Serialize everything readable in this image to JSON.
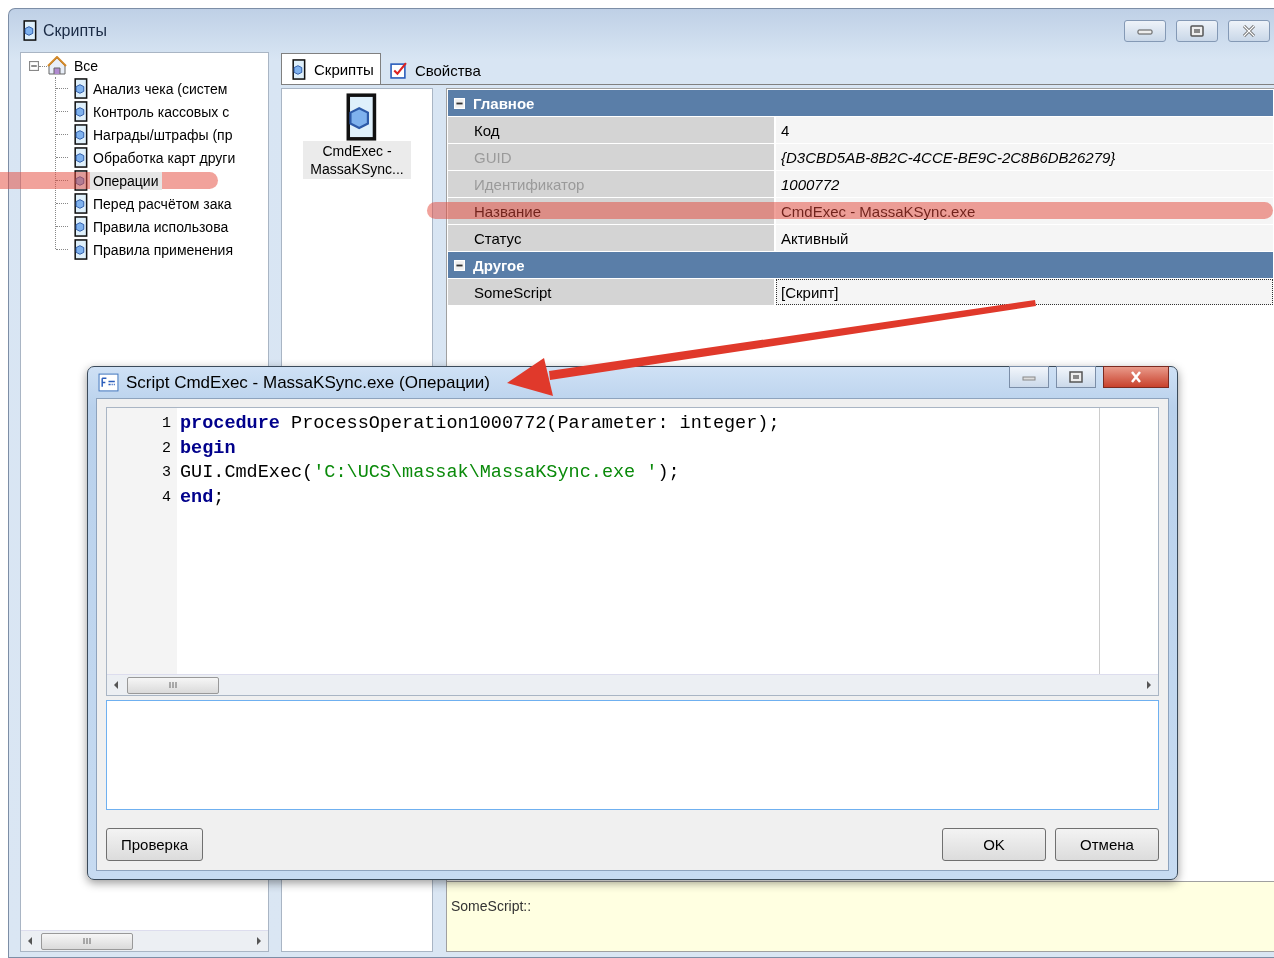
{
  "window": {
    "title": "Скрипты"
  },
  "tree": {
    "label": "Все",
    "expanded": true,
    "children": [
      {
        "label": "Анализ чека (систем",
        "selected": false,
        "highlighted": false
      },
      {
        "label": "Контроль кассовых с",
        "selected": false,
        "highlighted": false
      },
      {
        "label": "Награды/штрафы (пр",
        "selected": false,
        "highlighted": false
      },
      {
        "label": "Обработка карт други",
        "selected": false,
        "highlighted": false
      },
      {
        "label": "Операции",
        "selected": true,
        "highlighted": true
      },
      {
        "label": "Перед расчётом зака",
        "selected": false,
        "highlighted": false
      },
      {
        "label": "Правила использова",
        "selected": false,
        "highlighted": false
      },
      {
        "label": "Правила применения",
        "selected": false,
        "highlighted": false
      }
    ]
  },
  "tabs": [
    {
      "label": "Скрипты",
      "selected": true
    },
    {
      "label": "Свойства",
      "selected": false
    }
  ],
  "scripts": [
    {
      "label": "CmdExec - MassaKSync...",
      "selected": true
    }
  ],
  "properties": [
    {
      "title": "Главное",
      "expanded": true,
      "rows": [
        {
          "name": "Код",
          "value": "4",
          "disabled": false,
          "highlighted": false,
          "selected": false
        },
        {
          "name": "GUID",
          "value": "{D3CBD5AB-8B2C-4CCE-BE9C-2C8B6DB26279}",
          "disabled": true,
          "highlighted": false,
          "selected": false
        },
        {
          "name": "Идентификатор",
          "value": "1000772",
          "disabled": true,
          "highlighted": false,
          "selected": false
        },
        {
          "name": "Название",
          "value": "CmdExec - MassaKSync.exe",
          "disabled": false,
          "highlighted": true,
          "selected": false
        },
        {
          "name": "Статус",
          "value": "Активный",
          "disabled": false,
          "highlighted": false,
          "selected": false
        }
      ]
    },
    {
      "title": "Другое",
      "expanded": true,
      "rows": [
        {
          "name": "SomeScript",
          "value": "[Скрипт]",
          "disabled": false,
          "highlighted": false,
          "selected": true
        }
      ]
    }
  ],
  "description": "SomeScript::",
  "dialog": {
    "title": "Script CmdExec - MassaKSync.exe (Операции)",
    "code": [
      {
        "number": "1",
        "tokens": [
          {
            "kind": "keyword",
            "text": "procedure"
          },
          {
            "kind": "plain",
            "text": " ProcessOperation1000772(Parameter: integer);"
          }
        ]
      },
      {
        "number": "2",
        "tokens": [
          {
            "kind": "keyword",
            "text": "begin"
          }
        ]
      },
      {
        "number": "3",
        "tokens": [
          {
            "kind": "plain",
            "text": "GUI.CmdExec("
          },
          {
            "kind": "string",
            "text": "'C:\\UCS\\massak\\MassaKSync.exe '"
          },
          {
            "kind": "plain",
            "text": ");"
          }
        ]
      },
      {
        "number": "4",
        "tokens": [
          {
            "kind": "keyword",
            "text": "end"
          },
          {
            "kind": "plain",
            "text": ";"
          }
        ]
      }
    ],
    "left_buttons": [
      "Проверка"
    ],
    "right_buttons": [
      "OK",
      "Отмена"
    ]
  }
}
